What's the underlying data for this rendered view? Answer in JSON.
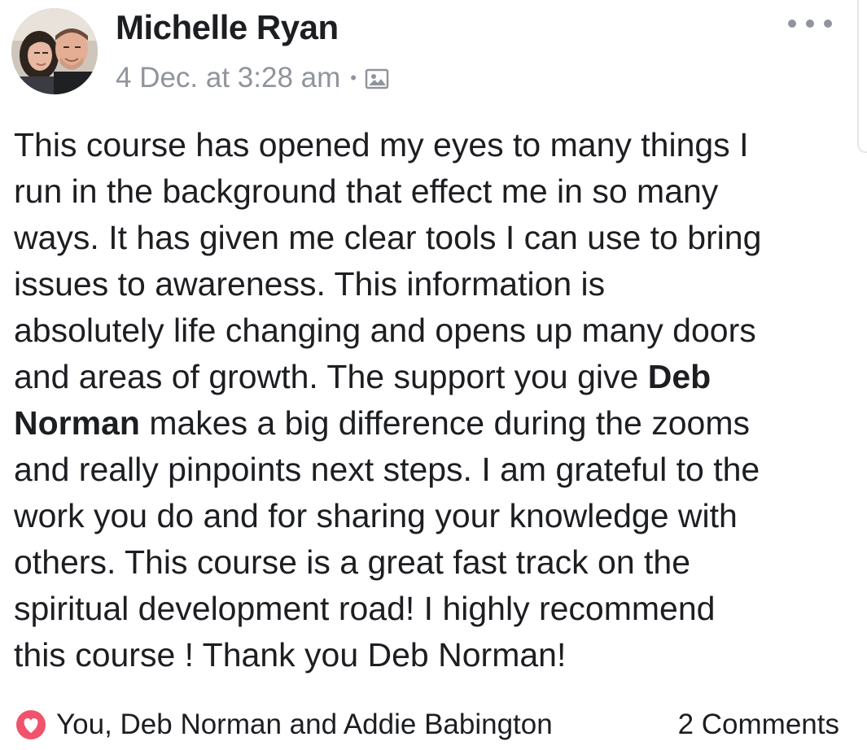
{
  "post": {
    "author_name": "Michelle Ryan",
    "timestamp": "4 Dec. at 3:28 am",
    "separator": "•",
    "audience_icon": "photo-icon",
    "body": {
      "line1": "This course has opened my eyes to many things I",
      "line2": "run in the background that effect me in so many",
      "line3": "ways. It has given me clear tools I can use to bring",
      "line4": "issues to awareness. This information is",
      "line5": "absolutely life changing and opens up many doors",
      "line6_a": "and areas of growth. The support you give ",
      "mention_first": "Deb",
      "mention_last": "Norman",
      "line7_b": " makes a big difference during the zooms",
      "line8": "and really pinpoints next steps. I am grateful to the",
      "line9": "work you do and for sharing your knowledge with",
      "line10": "others. This course is a great fast track on the",
      "line11": "spiritual development road! I highly recommend",
      "line12": "this course ! Thank you Deb Norman!"
    }
  },
  "reactions": {
    "icon": "love-icon",
    "text": "You, Deb Norman and Addie Babington"
  },
  "comments": {
    "label": "2 Comments"
  },
  "colors": {
    "text": "#1c1e21",
    "meta": "#90949c",
    "love": "#f0536c"
  }
}
